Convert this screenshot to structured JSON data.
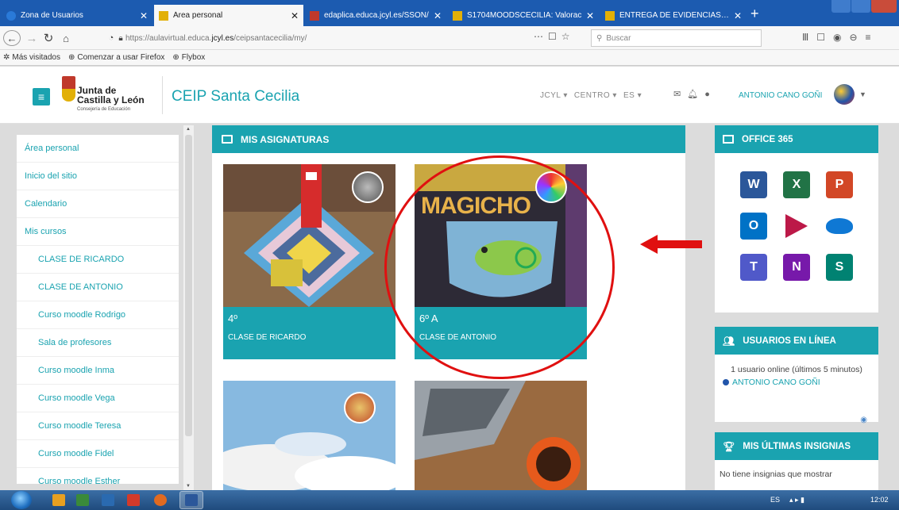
{
  "browser": {
    "tabs": [
      {
        "title": "Zona de Usuarios",
        "active": false
      },
      {
        "title": "Área personal",
        "active": true
      },
      {
        "title": "edaplica.educa.jcyl.es/SSON/",
        "active": false
      },
      {
        "title": "S1704MOODSCECILIA: Valorac",
        "active": false
      },
      {
        "title": "ENTREGA DE EVIDENCIAS DE A",
        "active": false
      }
    ],
    "url_prefix": "https://aulavirtual.educa.",
    "url_domain": "jcyl.es",
    "url_suffix": "/ceipsantacecilia/my/",
    "search_placeholder": "Buscar",
    "bookmarks": [
      "Más visitados",
      "Comenzar a usar Firefox",
      "Flybox"
    ]
  },
  "header": {
    "logo_line1": "Junta de",
    "logo_line2": "Castilla y León",
    "logo_sub": "Consejería de Educación",
    "site_title": "CEIP Santa Cecilia",
    "menu": [
      "JCYL",
      "CENTRO",
      "ES"
    ],
    "user_name": "ANTONIO CANO GOÑI"
  },
  "sidebar": {
    "items": [
      {
        "label": "Área personal",
        "sub": false
      },
      {
        "label": "Inicio del sitio",
        "sub": false
      },
      {
        "label": "Calendario",
        "sub": false
      },
      {
        "label": "Mis cursos",
        "sub": false
      },
      {
        "label": "CLASE DE RICARDO",
        "sub": true
      },
      {
        "label": "CLASE DE ANTONIO",
        "sub": true
      },
      {
        "label": "Curso moodle Rodrigo",
        "sub": true
      },
      {
        "label": "Sala de profesores",
        "sub": true
      },
      {
        "label": "Curso moodle Inma",
        "sub": true
      },
      {
        "label": "Curso moodle Vega",
        "sub": true
      },
      {
        "label": "Curso moodle Teresa",
        "sub": true
      },
      {
        "label": "Curso moodle Fidel",
        "sub": true
      },
      {
        "label": "Curso moodle Esther",
        "sub": true
      }
    ]
  },
  "main": {
    "title": "MIS ASIGNATURAS",
    "courses": [
      {
        "grade": "4º",
        "name": "CLASE DE RICARDO"
      },
      {
        "grade": "6º A",
        "name": "CLASE DE ANTONIO"
      }
    ]
  },
  "right": {
    "office_title": "OFFICE 365",
    "apps": [
      {
        "name": "word",
        "letter": "W",
        "color": "#2b579a"
      },
      {
        "name": "excel",
        "letter": "X",
        "color": "#217346"
      },
      {
        "name": "powerpoint",
        "letter": "P",
        "color": "#d24726"
      },
      {
        "name": "outlook",
        "letter": "O",
        "color": "#0072c6"
      },
      {
        "name": "stream",
        "letter": "",
        "color": "#bc1948"
      },
      {
        "name": "onedrive",
        "letter": "",
        "color": "#0f78d4"
      },
      {
        "name": "teams",
        "letter": "T",
        "color": "#5059c9"
      },
      {
        "name": "onenote",
        "letter": "N",
        "color": "#7719aa"
      },
      {
        "name": "sway",
        "letter": "S",
        "color": "#008272"
      }
    ],
    "online_title": "USUARIOS EN LÍNEA",
    "online_text": "1 usuario online (últimos 5 minutos)",
    "online_user": "ANTONIO CANO GOÑI",
    "badges_title": "MIS ÚLTIMAS INSIGNIAS",
    "badges_text": "No tiene insignias que mostrar"
  },
  "taskbar": {
    "tray": "ES",
    "clock": "12:02"
  },
  "colors": {
    "accent": "#1aa3b0",
    "highlight": "#e01010"
  }
}
